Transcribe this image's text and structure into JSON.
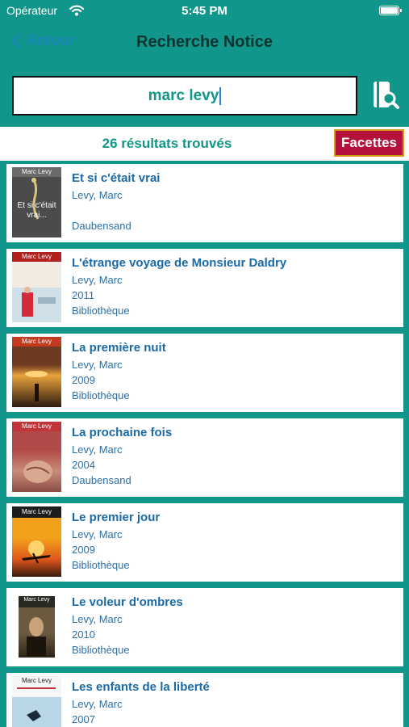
{
  "status_bar": {
    "carrier": "Opérateur",
    "time": "5:45 PM"
  },
  "nav": {
    "back_label": "Retour",
    "title": "Recherche Notice"
  },
  "search": {
    "query": "marc levy"
  },
  "results": {
    "count_label": "26 résultats trouvés",
    "facets_label": "Facettes"
  },
  "colors": {
    "teal": "#10968a",
    "link_blue": "#1a6aa7",
    "facets_red": "#b5123b"
  },
  "books": [
    {
      "title": "Et si c'était vrai",
      "author": "Levy, Marc",
      "year": "",
      "location": "Daubensand",
      "cover_author": "Marc Levy",
      "cover_title": "Et si c'était vrai..."
    },
    {
      "title": "L'étrange voyage de Monsieur Daldry",
      "author": "Levy, Marc",
      "year": "2011",
      "location": "Bibliothèque",
      "cover_author": "Marc Levy"
    },
    {
      "title": "La première nuit",
      "author": "Levy, Marc",
      "year": "2009",
      "location": "Bibliothèque",
      "cover_author": "Marc Levy"
    },
    {
      "title": "La prochaine fois",
      "author": "Levy, Marc",
      "year": "2004",
      "location": "Daubensand",
      "cover_author": "Marc Levy"
    },
    {
      "title": "Le premier jour",
      "author": "Levy, Marc",
      "year": "2009",
      "location": "Bibliothèque",
      "cover_author": "Marc Levy"
    },
    {
      "title": "Le voleur d'ombres",
      "author": "Levy, Marc",
      "year": "2010",
      "location": "Bibliothèque",
      "cover_author": "Marc Levy"
    },
    {
      "title": "Les enfants de la liberté",
      "author": "Levy, Marc",
      "year": "2007",
      "location": "",
      "cover_author": "Marc Levy"
    }
  ]
}
